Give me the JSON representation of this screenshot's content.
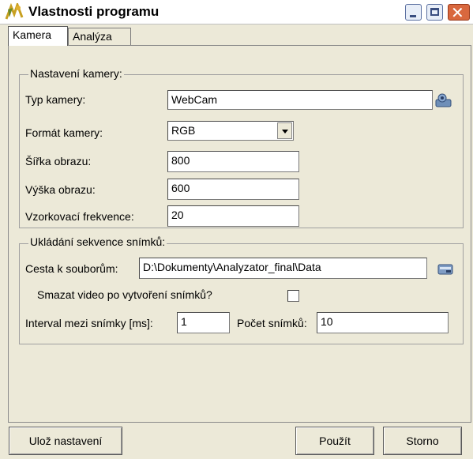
{
  "window": {
    "title": "Vlastnosti programu"
  },
  "tabs": [
    {
      "label": "Kamera"
    },
    {
      "label": "Analýza"
    }
  ],
  "camera": {
    "caption": "Nastavení kamery:",
    "type_label": "Typ kamery:",
    "type_value": "WebCam",
    "format_label": "Formát kamery:",
    "format_value": "RGB",
    "width_label": "Šířka obrazu:",
    "width_value": "800",
    "height_label": "Výška obrazu:",
    "height_value": "600",
    "rate_label": "Vzorkovací frekvence:",
    "rate_value": "20"
  },
  "sequence": {
    "caption": "Ukládání sekvence snímků:",
    "path_label": "Cesta k souborům:",
    "path_value": "D:\\Dokumenty\\Analyzator_final\\Data",
    "delete_label": "Smazat video po vytvoření snímků?",
    "delete_checked": false,
    "interval_label": "Interval mezi snímky [ms]:",
    "interval_value": "1",
    "count_label": "Počet snímků:",
    "count_value": "10"
  },
  "buttons": {
    "save": "Ulož nastavení",
    "apply": "Použít",
    "cancel": "Storno"
  },
  "icons": {
    "app": "app-icon",
    "camera_settings": "camera-settings-icon",
    "browse": "folder-browse-icon"
  }
}
